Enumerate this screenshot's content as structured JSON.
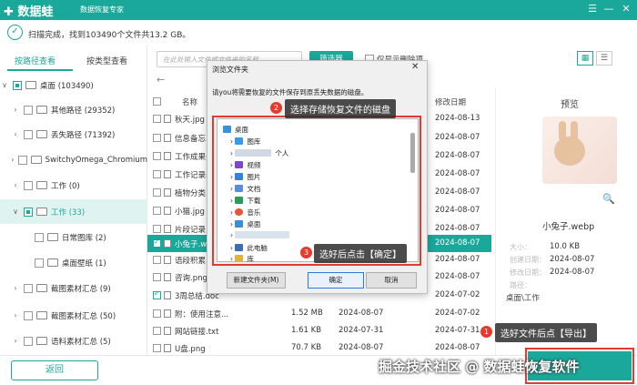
{
  "app": {
    "name": "数据蛙",
    "subtitle": "数据恢复专家"
  },
  "window": {
    "menu": "☰",
    "minimize": "—",
    "close": "✕"
  },
  "status": {
    "text": "扫描完成，找到103490个文件共13.2 GB。"
  },
  "left_tabs": {
    "path": "按路径查看",
    "type": "按类型查看"
  },
  "tree": [
    {
      "label": "桌面 (103490)"
    },
    {
      "label": "其他路径 (29352)"
    },
    {
      "label": "丢失路径 (71392)"
    },
    {
      "label": "SwitchyOmega_Chromium"
    },
    {
      "label": "工作 (0)"
    },
    {
      "label": "工作 (33)"
    },
    {
      "label": "日常图库 (2)"
    },
    {
      "label": "桌面壁纸 (1)"
    },
    {
      "label": "截图素材汇总 (9)"
    },
    {
      "label": "截图素材汇总 (50)"
    },
    {
      "label": "语料素材汇总 (5)"
    }
  ],
  "toolbar": {
    "search_placeholder": "在此处输入文件或文件夹的名称",
    "filter": "筛选器",
    "only_deleted": "仅显示删除项"
  },
  "columns": {
    "name": "名称",
    "date": "修改日期"
  },
  "files": [
    {
      "name": "秋天.jpg",
      "size": "",
      "type": "",
      "date": "2024-08-13",
      "checked": false
    },
    {
      "name": "信息备忘.t",
      "size": "",
      "type": "",
      "date": "2024-08-07",
      "checked": false
    },
    {
      "name": "工作成果分",
      "size": "",
      "type": "",
      "date": "2024-08-07",
      "checked": false
    },
    {
      "name": "工作记录表",
      "size": "",
      "type": "",
      "date": "2024-08-07",
      "checked": false
    },
    {
      "name": "植物分类.d",
      "size": "",
      "type": "",
      "date": "2024-08-07",
      "checked": false
    },
    {
      "name": "小猫.jpg",
      "size": "",
      "type": "",
      "date": "2024-08-07",
      "checked": false
    },
    {
      "name": "片段记录.d",
      "size": "",
      "type": "",
      "date": "2024-08-07",
      "checked": false
    },
    {
      "name": "小兔子.web",
      "size": "",
      "type": "",
      "date": "2024-08-07",
      "checked": true
    },
    {
      "name": "语段积累.d",
      "size": "",
      "type": "",
      "date": "2024-08-07",
      "checked": false
    },
    {
      "name": "咨询.png",
      "size": "",
      "type": "",
      "date": "2024-08-07",
      "checked": false
    },
    {
      "name": "3周总结.doc",
      "size": "",
      "type": "",
      "date": "2024-07-02",
      "checked": true
    },
    {
      "name": "附：使用注意...",
      "size": "1.52 MB",
      "type": "2024-08-07",
      "date": "2024-07-02",
      "checked": false
    },
    {
      "name": "网站链接.txt",
      "size": "1.61 KB",
      "type": "2024-07-31",
      "date": "2024-07-31",
      "checked": false
    },
    {
      "name": "U盘.png",
      "size": "70.7 KB",
      "type": "2024-08-07",
      "date": "2024-08-07",
      "checked": false
    }
  ],
  "preview": {
    "title": "预览",
    "filename": "小兔子.webp",
    "size_key": "大小：",
    "size": "10.0 KB",
    "created_key": "创建日期：",
    "created": "2024-08-07",
    "modified_key": "修改日期：",
    "modified": "2024-08-07",
    "path_key": "路径：",
    "path": "桌面\\工作"
  },
  "dialog": {
    "title": "浏览文件夹",
    "close": "✕",
    "desc": "请you将需要恢复的文件保存到原丢失数据的磁盘。",
    "tree": [
      {
        "label": "桌面",
        "color": "#3b8fd6"
      },
      {
        "label": "图库",
        "color": "#3a9ae6"
      },
      {
        "label": "个人",
        "color": "#cccccc"
      },
      {
        "label": "视频",
        "color": "#7b49c9"
      },
      {
        "label": "图片",
        "color": "#2f86d9"
      },
      {
        "label": "文档",
        "color": "#5a8fd6"
      },
      {
        "label": "下载",
        "color": "#2a9c5a"
      },
      {
        "label": "音乐",
        "color": "#e2563a"
      },
      {
        "label": "桌面",
        "color": "#3b8fd6"
      },
      {
        "label": "",
        "color": "#dddddd"
      },
      {
        "label": "此电脑",
        "color": "#3c6fb0"
      },
      {
        "label": "库",
        "color": "#e2b338"
      }
    ],
    "new_folder": "新建文件夹(M)",
    "ok": "确定",
    "cancel": "取消"
  },
  "callouts": {
    "c1": "选好文件后点【导出】",
    "c2": "选择存储恢复文件的磁盘",
    "c3": "选好后点击【确定】",
    "b1": "1",
    "b2": "2",
    "b3": "3"
  },
  "footer": {
    "back": "返回",
    "watermark": "掘金技术社区 @ 数据蛙恢复软件"
  }
}
